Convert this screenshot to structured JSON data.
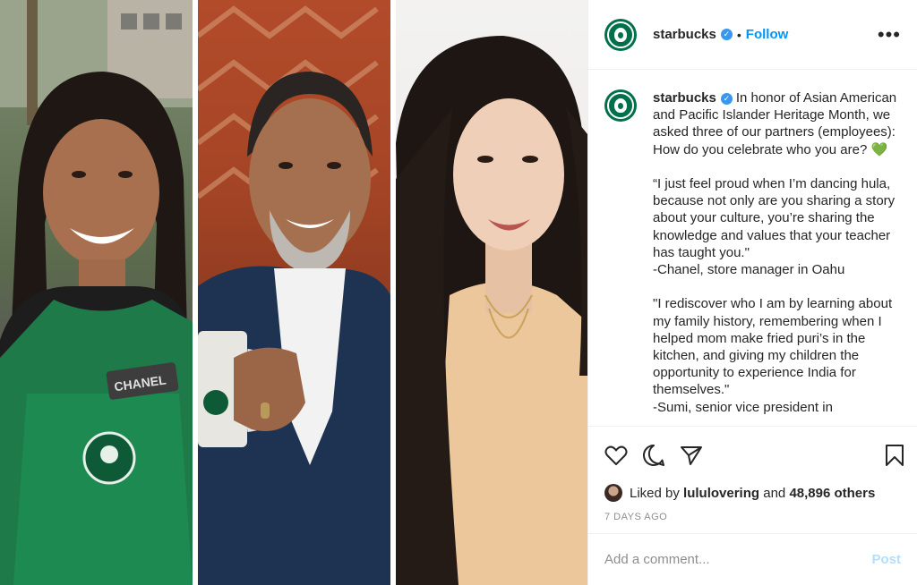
{
  "header": {
    "username": "starbucks",
    "verified_icon": "verified-badge-icon",
    "follow_label": "Follow",
    "more_icon": "more-options-icon"
  },
  "caption": {
    "username": "starbucks",
    "text": "In honor of Asian American and Pacific Islander Heritage Month, we asked three of our partners (employees): How do you celebrate who you are? 💚\n\n“I just feel proud when I’m dancing hula, because not only are you sharing a story about your culture, you’re sharing the knowledge and values that your teacher has taught you.\"\n-Chanel, store manager in Oahu\n\n\"I rediscover who I am by learning about my family history, remembering when I helped mom make fried puri’s in the kitchen, and giving my children the opportunity to experience India for themselves.\"\n-Sumi, senior vice president in"
  },
  "actions": {
    "like_icon": "heart-icon",
    "comment_icon": "comment-icon",
    "share_icon": "share-icon",
    "save_icon": "bookmark-icon"
  },
  "likes": {
    "prefix": "Liked by",
    "user": "lululovering",
    "middle": "and",
    "count": "48,896 others"
  },
  "date": "7 DAYS AGO",
  "comment_box": {
    "placeholder": "Add a comment...",
    "post_label": "Post"
  },
  "media": {
    "apron_name_tag": "CHANEL"
  },
  "colors": {
    "brand_green": "#00704a",
    "link_blue": "#0095f6",
    "muted": "#8e8e8e"
  }
}
